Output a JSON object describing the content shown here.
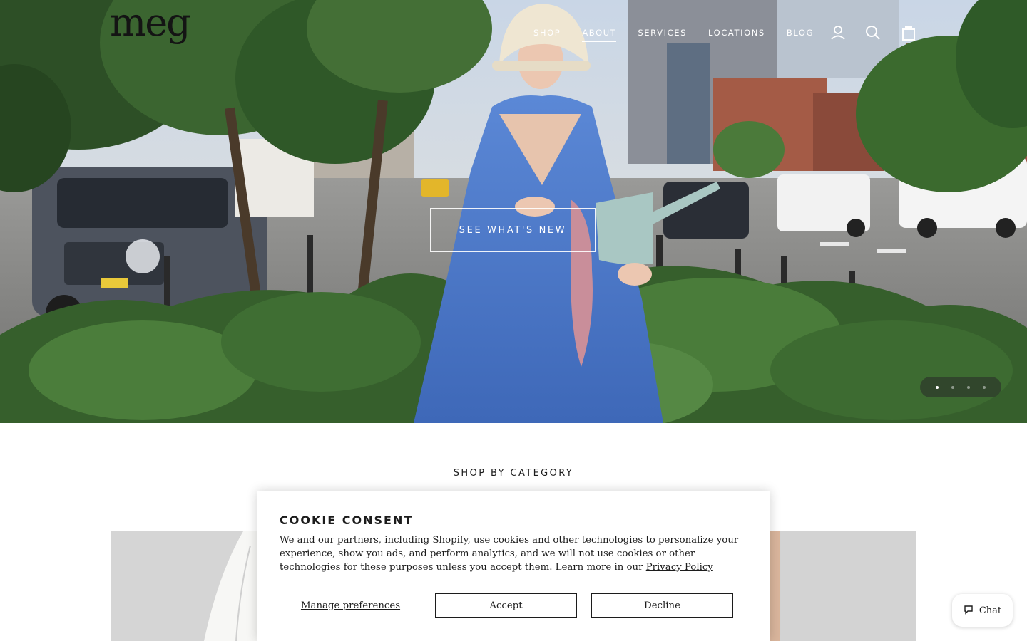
{
  "brand": {
    "logo_text": "meg"
  },
  "nav": {
    "items": [
      {
        "label": "SHOP"
      },
      {
        "label": "ABOUT",
        "active": true
      },
      {
        "label": "SERVICES"
      },
      {
        "label": "LOCATIONS"
      },
      {
        "label": "BLOG"
      }
    ],
    "icons": [
      "account-icon",
      "search-icon",
      "cart-icon"
    ]
  },
  "hero": {
    "cta_label": "SEE WHAT'S NEW",
    "slides_total": 4,
    "active_slide": 1
  },
  "category": {
    "title": "SHOP BY CATEGORY"
  },
  "cookie": {
    "title": "COOKIE CONSENT",
    "body": "We and our partners, including Shopify, use cookies and other technologies to personalize your experience, show you ads, and perform analytics, and we will not use cookies or other technologies for these purposes unless you accept them. Learn more in our ",
    "link_label": "Privacy Policy",
    "manage_label": "Manage preferences",
    "accept_label": "Accept",
    "decline_label": "Decline"
  },
  "chat": {
    "label": "Chat"
  },
  "colors": {
    "dress": "#4a78c8",
    "foliage": "#2f5a2a",
    "street": "#8c8c8c",
    "text": "#1c1c1c"
  }
}
